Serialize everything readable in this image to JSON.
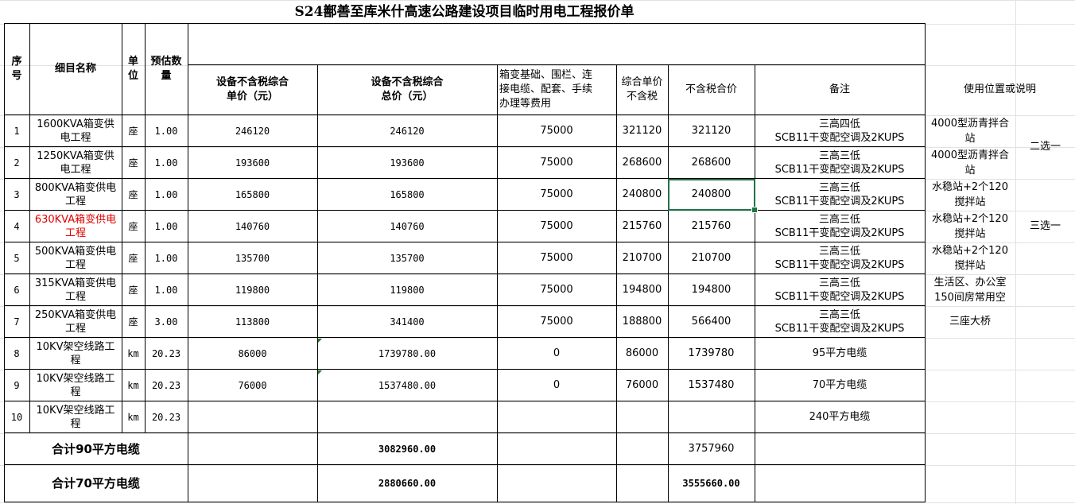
{
  "title": "S24鄯善至库米什高速公路建设项目临时用电工程报价单",
  "headers": {
    "seq": "序\n号",
    "name": "细目名称",
    "unit": "单\n位",
    "qty": "预估数\n量",
    "equip_unit_price": "设备不含税综合\n单价（元）",
    "equip_total": "设备不含税综合\n总价（元）",
    "foundation": "箱变基础、围栏、连\n接电缆、配套、手续\n办理等费用",
    "unit_price_ex": "综合单价\n不含税",
    "total_ex": "不含税合价",
    "remark": "备注",
    "usage": "使用位置或说明"
  },
  "rows": [
    {
      "seq": "1",
      "name": "1600KVA箱变供\n电工程",
      "unit": "座",
      "qty": "1.00",
      "equip_unit_price": "246120",
      "equip_total": "246120",
      "foundation": "75000",
      "unit_price_ex": "321120",
      "total_ex": "321120",
      "remark": "三高四低\nSCB11干变配空调及2KUPS"
    },
    {
      "seq": "2",
      "name": "1250KVA箱变供\n电工程",
      "unit": "座",
      "qty": "1.00",
      "equip_unit_price": "193600",
      "equip_total": "193600",
      "foundation": "75000",
      "unit_price_ex": "268600",
      "total_ex": "268600",
      "remark": "三高三低\nSCB11干变配空调及2KUPS"
    },
    {
      "seq": "3",
      "name": "800KVA箱变供电\n工程",
      "unit": "座",
      "qty": "1.00",
      "equip_unit_price": "165800",
      "equip_total": "165800",
      "foundation": "75000",
      "unit_price_ex": "240800",
      "total_ex": "240800",
      "remark": "三高三低\nSCB11干变配空调及2KUPS"
    },
    {
      "seq": "4",
      "name": "630KVA箱变供电\n工程",
      "unit": "座",
      "qty": "1.00",
      "equip_unit_price": "140760",
      "equip_total": "140760",
      "foundation": "75000",
      "unit_price_ex": "215760",
      "total_ex": "215760",
      "remark": "三高三低\nSCB11干变配空调及2KUPS"
    },
    {
      "seq": "5",
      "name": "500KVA箱变供电\n工程",
      "unit": "座",
      "qty": "1.00",
      "equip_unit_price": "135700",
      "equip_total": "135700",
      "foundation": "75000",
      "unit_price_ex": "210700",
      "total_ex": "210700",
      "remark": "三高三低\nSCB11干变配空调及2KUPS"
    },
    {
      "seq": "6",
      "name": "315KVA箱变供电\n工程",
      "unit": "座",
      "qty": "1.00",
      "equip_unit_price": "119800",
      "equip_total": "119800",
      "foundation": "75000",
      "unit_price_ex": "194800",
      "total_ex": "194800",
      "remark": "三高三低\nSCB11干变配空调及2KUPS"
    },
    {
      "seq": "7",
      "name": "250KVA箱变供电\n工程",
      "unit": "座",
      "qty": "3.00",
      "equip_unit_price": "113800",
      "equip_total": "341400",
      "foundation": "75000",
      "unit_price_ex": "188800",
      "total_ex": "566400",
      "remark": "三高三低\nSCB11干变配空调及2KUPS"
    },
    {
      "seq": "8",
      "name": "10KV架空线路工\n程",
      "unit": "km",
      "qty": "20.23",
      "equip_unit_price": "86000",
      "equip_total": "1739780.00",
      "foundation": "0",
      "unit_price_ex": "86000",
      "total_ex": "1739780",
      "remark": "95平方电缆"
    },
    {
      "seq": "9",
      "name": "10KV架空线路工\n程",
      "unit": "km",
      "qty": "20.23",
      "equip_unit_price": "76000",
      "equip_total": "1537480.00",
      "foundation": "0",
      "unit_price_ex": "76000",
      "total_ex": "1537480",
      "remark": "70平方电缆"
    },
    {
      "seq": "10",
      "name": "10KV架空线路工\n程",
      "unit": "km",
      "qty": "20.23",
      "equip_unit_price": "",
      "equip_total": "",
      "foundation": "",
      "unit_price_ex": "",
      "total_ex": "",
      "remark": "240平方电缆"
    }
  ],
  "usage": [
    "4000型沥青拌合\n站",
    "4000型沥青拌合\n站",
    "水稳站+2个120\n搅拌站",
    "水稳站+2个120\n搅拌站",
    "水稳站+2个120\n搅拌站",
    "生活区、办公室\n150间房常用空",
    "三座大桥"
  ],
  "choice_2": "二选一",
  "choice_3": "三选一",
  "totals": [
    {
      "label": "合计90平方电缆",
      "equip_total": "3082960.00",
      "total_ex": "3757960"
    },
    {
      "label": "合计70平方电缆",
      "equip_total": "2880660.00",
      "total_ex": "3555660.00"
    }
  ],
  "colors": {
    "selection": "#217346",
    "red_text": "#e00000",
    "comment_marker": "#1b7a2e"
  }
}
